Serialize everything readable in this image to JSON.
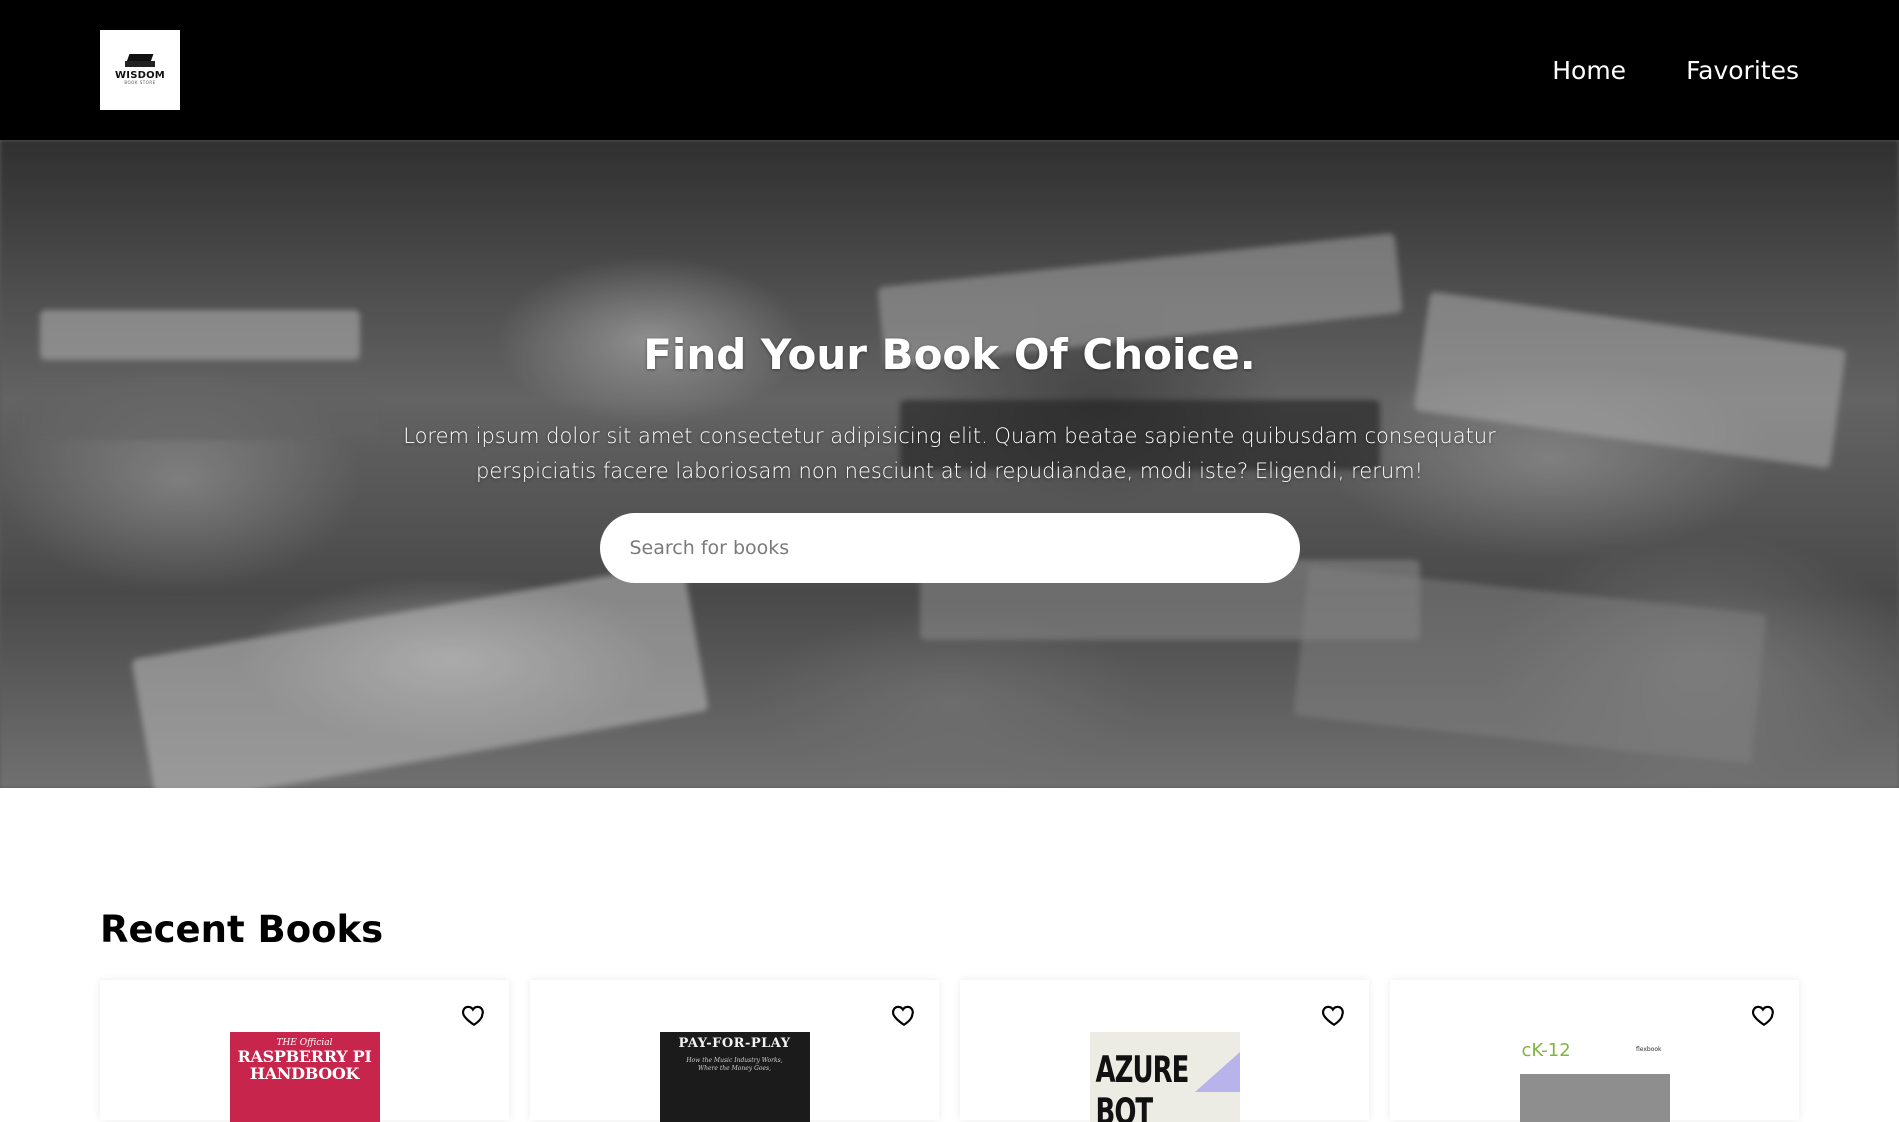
{
  "header": {
    "logo": {
      "title": "WISDOM",
      "subtitle": "BOOK STORE"
    },
    "nav": [
      {
        "label": "Home"
      },
      {
        "label": "Favorites"
      }
    ]
  },
  "hero": {
    "title": "Find Your Book Of Choice.",
    "text": "Lorem ipsum dolor sit amet consectetur adipisicing elit. Quam beatae sapiente quibusdam consequatur perspiciatis facere laboriosam non nesciunt at id repudiandae, modi iste? Eligendi, rerum!",
    "search_placeholder": "Search for books"
  },
  "recent": {
    "title": "Recent Books",
    "books": [
      {
        "cover_line1": "THE Official",
        "cover_line2": "RASPBERRY PI",
        "cover_line3": "HANDBOOK",
        "color": "#c8254d"
      },
      {
        "cover_line1": "PAY-FOR-PLAY",
        "cover_line2": "How the Music Industry Works,",
        "cover_line3": "Where the Money Goes,",
        "color": "#1b1b1b"
      },
      {
        "cover_line1": "AZURE BOT",
        "color": "#ecebe4"
      },
      {
        "cover_line1": "cK-12",
        "cover_line2": "flexbook",
        "color": "#ffffff"
      }
    ]
  }
}
